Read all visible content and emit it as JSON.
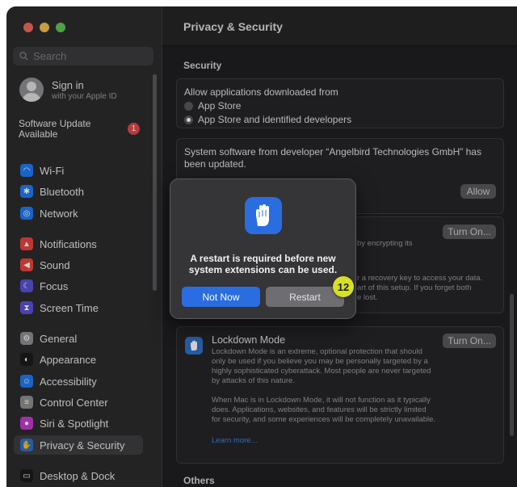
{
  "sidebar": {
    "search_placeholder": "Search",
    "signin_title": "Sign in",
    "signin_sub": "with your Apple ID",
    "software_update": "Software Update Available",
    "update_badge": "1",
    "items": [
      {
        "label": "Wi-Fi",
        "icon": "wifi-icon",
        "color": "#1e7cf2"
      },
      {
        "label": "Bluetooth",
        "icon": "bluetooth-icon",
        "color": "#1e7cf2"
      },
      {
        "label": "Network",
        "icon": "globe-icon",
        "color": "#1e7cf2"
      },
      {
        "label": "Notifications",
        "icon": "bell-icon",
        "color": "#e8453c"
      },
      {
        "label": "Sound",
        "icon": "speaker-icon",
        "color": "#e8453c"
      },
      {
        "label": "Focus",
        "icon": "moon-icon",
        "color": "#5a52d6"
      },
      {
        "label": "Screen Time",
        "icon": "hourglass-icon",
        "color": "#5a52d6"
      },
      {
        "label": "General",
        "icon": "gear-icon",
        "color": "#8e8d92"
      },
      {
        "label": "Appearance",
        "icon": "appearance-icon",
        "color": "#1a1a1a"
      },
      {
        "label": "Accessibility",
        "icon": "accessibility-icon",
        "color": "#1e7cf2"
      },
      {
        "label": "Control Center",
        "icon": "control-center-icon",
        "color": "#8e8d92"
      },
      {
        "label": "Siri & Spotlight",
        "icon": "siri-icon",
        "color": "#c43bd0"
      },
      {
        "label": "Privacy & Security",
        "icon": "hand-icon",
        "color": "#2f6fc8"
      },
      {
        "label": "Desktop & Dock",
        "icon": "dock-icon",
        "color": "#1a1a1a"
      }
    ],
    "selected": "Privacy & Security"
  },
  "header": {
    "title": "Privacy & Security"
  },
  "security": {
    "section_title": "Security",
    "allow_label": "Allow applications downloaded from",
    "options": [
      "App Store",
      "App Store and identified developers"
    ],
    "selected_option": "App Store and identified developers",
    "ext_message": "System software from developer “Angelbird Technologies GmbH” has been updated.",
    "allow_button": "Allow",
    "filevault_button": "Turn On...",
    "filevault_desc_1": "by encrypting its",
    "filevault_desc_2": "r a recovery key to access your data.",
    "filevault_desc_3": "art of this setup. If you forget both",
    "filevault_desc_4": "e lost."
  },
  "lockdown": {
    "title": "Lockdown Mode",
    "button": "Turn On...",
    "desc1": "Lockdown Mode is an extreme, optional protection that should only be used if you believe you may be personally targeted by a highly sophisticated cyberattack. Most people are never targeted by attacks of this nature.",
    "desc2": "When Mac is in Lockdown Mode, it will not function as it typically does. Applications, websites, and features will be strictly limited for security, and some experiences will be completely unavailable.",
    "learn_more": "Learn more..."
  },
  "others": {
    "section_title": "Others"
  },
  "dialog": {
    "message": "A restart is required before new system extensions can be used.",
    "not_now": "Not Now",
    "restart": "Restart"
  },
  "step_badge": "12",
  "colors": {
    "accent": "#2a6de0",
    "badge": "#e0494a",
    "step": "#d7e021"
  }
}
